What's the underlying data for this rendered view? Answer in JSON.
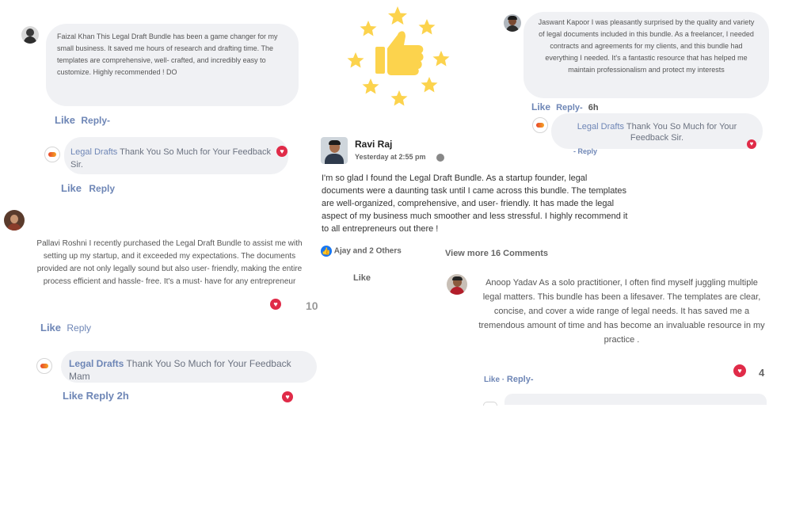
{
  "colors": {
    "accent": "#6e86b6",
    "heart": "#e02b48",
    "bubble": "#f0f1f4",
    "star": "#fcd34d"
  },
  "c1": {
    "text": "Faizal Khan This Legal Draft Bundle has been a game changer for my small business. It saved me hours of research and drafting time. The templates are comprehensive, well- crafted, and incredibly easy to customize. Highly recommended ! DO",
    "like": "Like",
    "reply": "Reply-"
  },
  "r1": {
    "name": "Legal Drafts",
    "text": " Thank You So Much for Your Feedback Sir.",
    "like": "Like",
    "reply": "Reply"
  },
  "c2": {
    "text": "Pallavi Roshni I recently purchased the Legal Draft Bundle to assist me with setting up my startup, and it exceeded my expectations. The documents provided are not only legally sound but also user- friendly, making the entire process efficient and hassle- free. It's a must- have for any entrepreneur",
    "count": "10",
    "like": "Like",
    "reply": "Reply"
  },
  "r2": {
    "name": "Legal Drafts",
    "text": " Thank You So Much for Your Feedback Mam",
    "like": "Like",
    "reply": "Reply",
    "time": "2h"
  },
  "post": {
    "author": "Ravi Raj",
    "time": "Yesterday at 2:55 pm",
    "body": "I'm so glad I found the Legal Draft Bundle. As a startup founder, legal documents were a daunting task until I came across this bundle. The templates are well-organized, comprehensive, and user- friendly. It has made the legal aspect of my business much smoother and less stressful. I highly recommend it to all entrepreneurs out there !",
    "reactions": "Ajay and 2 Others",
    "view_more": "View more 16 Comments",
    "like": "Like"
  },
  "c3": {
    "text": "Jaswant Kapoor I was pleasantly surprised by the quality and variety of legal documents included in this bundle. As a freelancer, I needed contracts and agreements for my clients, and this bundle had everything I needed. It's a fantastic resource that has helped me maintain professionalism and protect my interests",
    "like": "Like",
    "reply": "Reply-",
    "time": "6h"
  },
  "r3": {
    "name": "Legal Drafts",
    "text": " Thank You So Much for Your Feedback Sir.",
    "reply": "- Reply"
  },
  "c4": {
    "text": "Anoop Yadav As a solo practitioner, I often find myself juggling multiple legal matters. This bundle has been a lifesaver. The templates are clear, concise, and cover a wide range of legal needs. It has saved me a tremendous amount of time and has become an invaluable resource in my practice .",
    "count": "4",
    "like": "Like",
    "reply": "Reply-"
  }
}
